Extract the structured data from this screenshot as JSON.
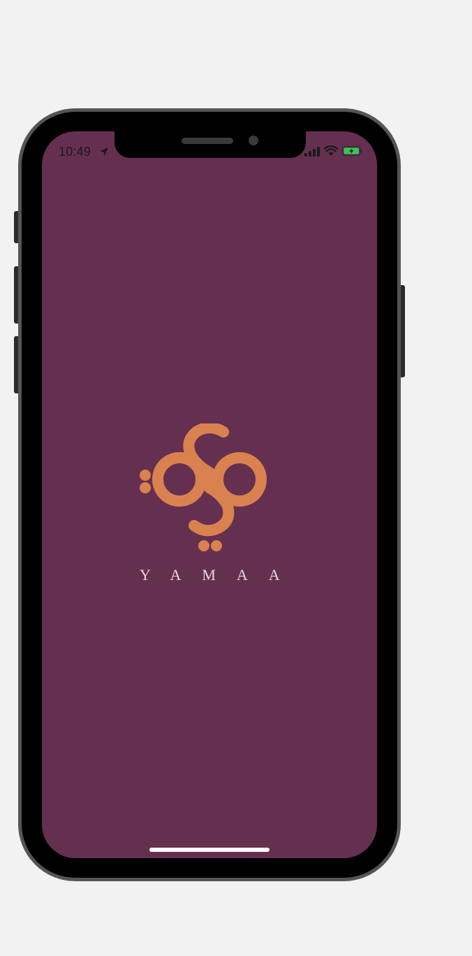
{
  "colors": {
    "screen_background": "#653050",
    "logo": "#d9824f",
    "brand_text": "#e6d8df",
    "phone_body": "#000000",
    "phone_rim": "#555555",
    "page_background": "#f2f2f2",
    "battery_fill": "#35c759"
  },
  "status_bar": {
    "time": "10:49",
    "location_icon": "location-arrow-icon",
    "signal_icon": "cellular-signal-icon",
    "wifi_icon": "wifi-icon",
    "battery_icon": "battery-charging-icon"
  },
  "splash": {
    "logo_icon": "yamaa-logo-icon",
    "brand_name": "YAMAA"
  }
}
